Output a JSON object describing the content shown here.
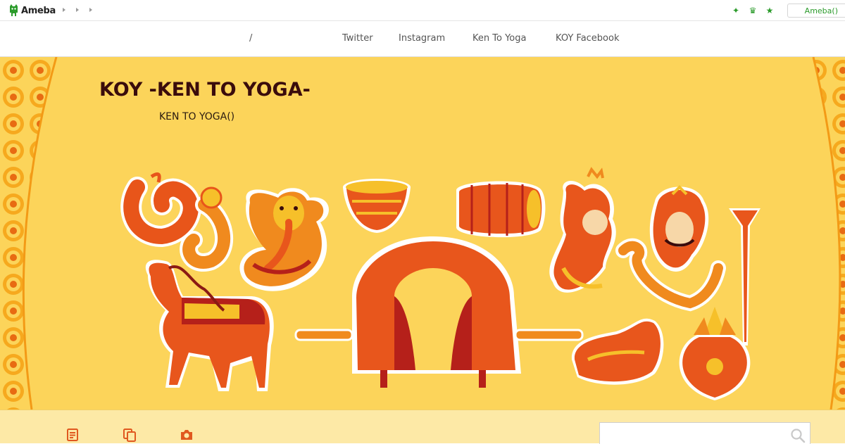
{
  "ameba_bar": {
    "logo_text": "Ameba",
    "right_icons": [
      "sparkle-icon",
      "crown-icon",
      "star-icon"
    ],
    "login_label": "Ameba()"
  },
  "nav": {
    "items": [
      {
        "label": "/"
      },
      {
        "label": "Twitter"
      },
      {
        "label": "Instagram"
      },
      {
        "label": "Ken To Yoga"
      },
      {
        "label": "KOY Facebook"
      }
    ]
  },
  "hero": {
    "title": "KOY -KEN TO YOGA-",
    "description": "KEN TO YOGA()"
  },
  "bottom_bar": {
    "icons": [
      "article-list-icon",
      "copy-icon",
      "camera-icon"
    ],
    "search": {
      "value": "",
      "placeholder": ""
    }
  },
  "colors": {
    "hero_bg": "#fcd45a",
    "title": "#3a0c0c",
    "ameba_green": "#2b9b2b",
    "bottom_bg": "#fde9a6",
    "icon_orange": "#e0581f"
  }
}
